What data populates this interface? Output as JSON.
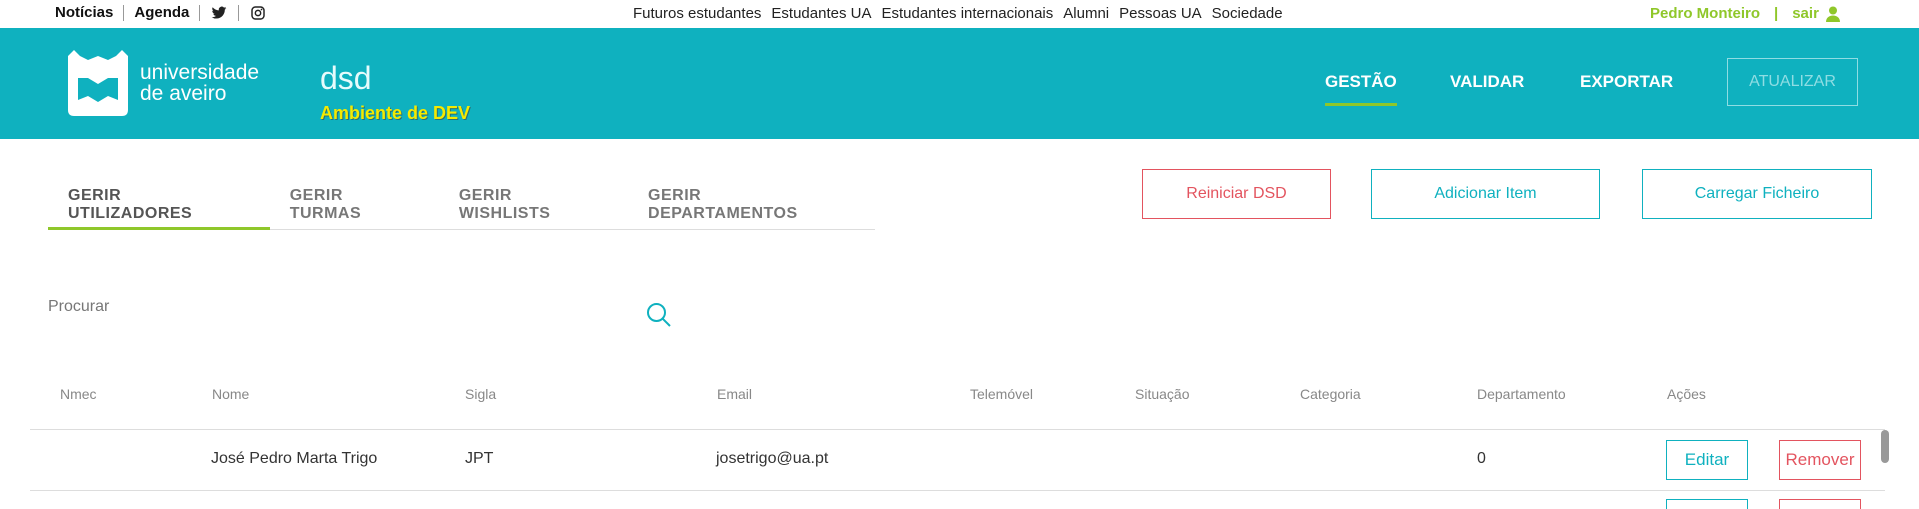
{
  "topbar": {
    "left_links": [
      "Notícias",
      "Agenda"
    ],
    "center_links": [
      "Futuros estudantes",
      "Estudantes UA",
      "Estudantes internacionais",
      "Alumni",
      "Pessoas UA",
      "Sociedade"
    ],
    "user_name": "Pedro Monteiro",
    "separator": "|",
    "logout": "sair",
    "accent_color": "#8fc72a"
  },
  "header": {
    "logo_line1": "universidade",
    "logo_line2": "de aveiro",
    "app_title": "dsd",
    "env_label": "Ambiente de DEV",
    "nav": [
      "GESTÃO",
      "VALIDAR",
      "EXPORTAR"
    ],
    "update_button": "ATUALIZAR",
    "bg_color": "#0fb1bf"
  },
  "tabs": [
    "GERIR UTILIZADORES",
    "GERIR TURMAS",
    "GERIR WISHLISTS",
    "GERIR DEPARTAMENTOS"
  ],
  "actions": {
    "reset": "Reiniciar DSD",
    "add": "Adicionar Item",
    "upload": "Carregar Ficheiro"
  },
  "search": {
    "placeholder": "Procurar"
  },
  "table": {
    "headers": [
      "Nmec",
      "Nome",
      "Sigla",
      "Email",
      "Telemóvel",
      "Situação",
      "Categoria",
      "Departamento",
      "Ações"
    ],
    "rows": [
      {
        "nmec": "",
        "nome": "José Pedro Marta Trigo",
        "sigla": "JPT",
        "email": "josetrigo@ua.pt",
        "telemovel": "",
        "situacao": "",
        "categoria": "",
        "departamento": "0",
        "edit": "Editar",
        "remove": "Remover"
      }
    ]
  }
}
